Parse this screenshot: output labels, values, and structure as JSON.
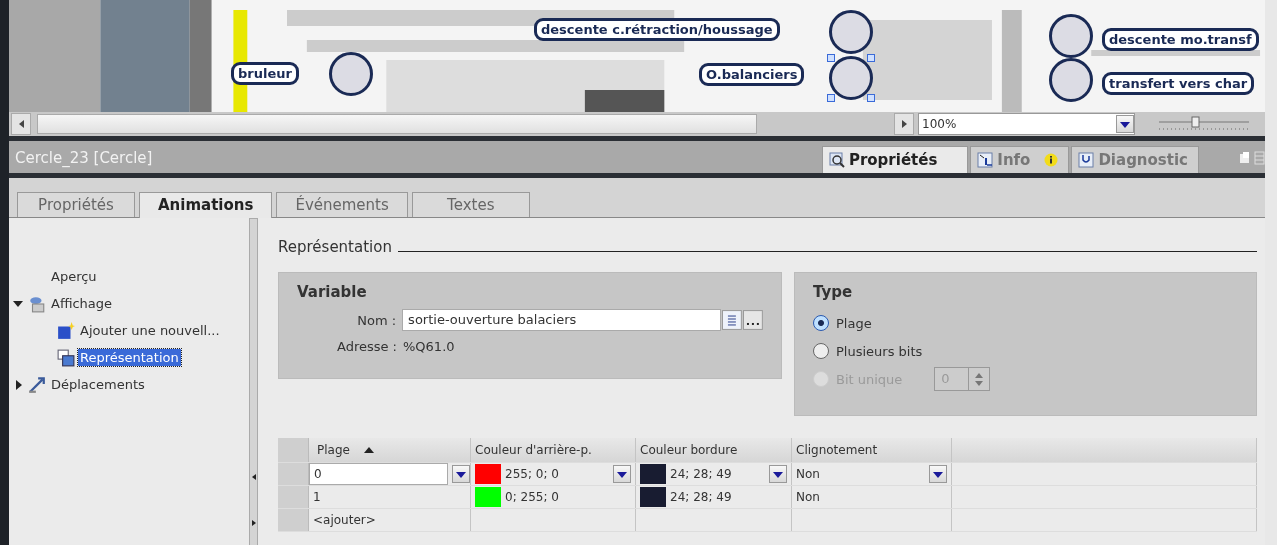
{
  "canvas": {
    "labels": [
      {
        "text": "descente c.rétraction/houssage"
      },
      {
        "text": "bruleur"
      },
      {
        "text": "O.balanciers"
      },
      {
        "text": "descente mo.transf"
      },
      {
        "text": "transfert vers char"
      }
    ],
    "circles": [
      {
        "selected": false
      },
      {
        "selected": false
      },
      {
        "selected": true
      },
      {
        "selected": false
      },
      {
        "selected": false
      }
    ],
    "zoom": "100%"
  },
  "panel": {
    "title": "Cercle_23 [Cercle]",
    "inspector_tabs": [
      {
        "label": "Propriétés",
        "selected": true,
        "kind": "props"
      },
      {
        "label": "Info",
        "selected": false,
        "kind": "info"
      },
      {
        "label": "Diagnostic",
        "selected": false,
        "kind": "diag"
      }
    ],
    "tabs": [
      {
        "label": "Propriétés",
        "selected": false
      },
      {
        "label": "Animations",
        "selected": true
      },
      {
        "label": "Événements",
        "selected": false
      },
      {
        "label": "Textes",
        "selected": false
      }
    ]
  },
  "tree": [
    {
      "label": "Aperçu",
      "kind": "plain",
      "selected": false
    },
    {
      "label": "Affichage",
      "kind": "display",
      "expanded": true,
      "selected": false,
      "children": [
        {
          "label": "Ajouter une nouvell...",
          "kind": "add",
          "selected": false
        },
        {
          "label": "Représentation",
          "kind": "repr",
          "selected": true
        }
      ]
    },
    {
      "label": "Déplacements",
      "kind": "move",
      "expanded": false,
      "selected": false
    }
  ],
  "section_title": "Représentation",
  "variable": {
    "title": "Variable",
    "name_label": "Nom :",
    "name": "sortie-ouverture balaciers",
    "address_label": "Adresse :",
    "address": "%Q61.0"
  },
  "type": {
    "title": "Type",
    "options": [
      {
        "label": "Plage",
        "selected": true,
        "disabled": false
      },
      {
        "label": "Plusieurs bits",
        "selected": false,
        "disabled": false
      },
      {
        "label": "Bit unique",
        "selected": false,
        "disabled": true
      }
    ],
    "bit": "0"
  },
  "table": {
    "columns": [
      "Plage",
      "Couleur  d'arrière-p.",
      "Couleur bordure",
      "Clignotement"
    ],
    "rows": [
      {
        "kind": "value",
        "plage": "0",
        "bg": "255; 0; 0",
        "border": "24; 28; 49",
        "blink": "Non",
        "editing": true
      },
      {
        "kind": "value",
        "plage": "1",
        "bg": "0; 255; 0",
        "border": "24; 28; 49",
        "blink": "Non",
        "editing": false
      },
      {
        "plage": "<ajouter>",
        "kind": "add"
      }
    ]
  }
}
